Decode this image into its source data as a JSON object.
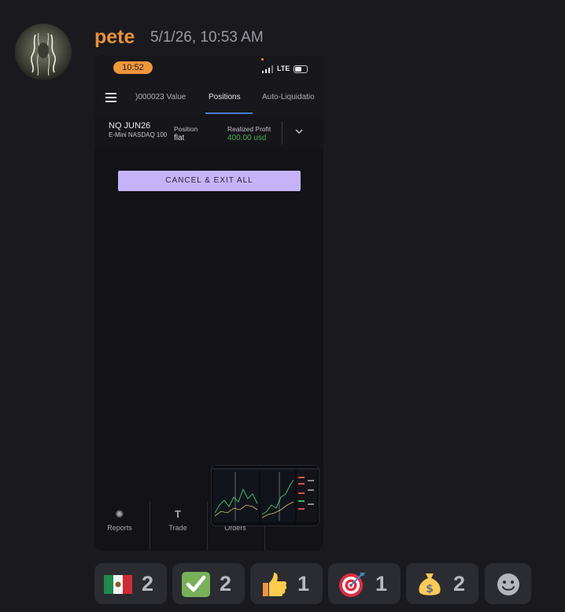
{
  "message": {
    "username": "pete",
    "timestamp": "5/1/26, 10:53 AM",
    "username_color": "#e8923d"
  },
  "phone": {
    "status_time": "10:52",
    "network": "LTE",
    "tabs": [
      {
        "label": ")000023 Value"
      },
      {
        "label": "Positions",
        "active": true
      },
      {
        "label": "Auto-Liquidatio"
      }
    ],
    "position": {
      "symbol": "NQ JUN26",
      "description": "E-Mini NASDAQ 100",
      "position_label": "Position",
      "position_value": "flat",
      "profit_label": "Realized Profit",
      "profit_value": "400.00 usd",
      "profit_color": "#4caf50"
    },
    "cancel_button": "CANCEL & EXIT ALL",
    "nav": [
      {
        "label": "Reports",
        "icon": "reports-icon"
      },
      {
        "label": "Trade",
        "icon": "trade-icon"
      },
      {
        "label": "Orders",
        "icon": "orders-icon"
      }
    ]
  },
  "reactions": [
    {
      "emoji": "mexico-flag",
      "count": "2"
    },
    {
      "emoji": "check-mark",
      "count": "2"
    },
    {
      "emoji": "thumbs-up",
      "count": "1"
    },
    {
      "emoji": "direct-hit-target",
      "count": "1"
    },
    {
      "emoji": "money-bag",
      "count": "2"
    }
  ],
  "add_reaction": {
    "icon": "add-reaction-smiley-icon"
  }
}
